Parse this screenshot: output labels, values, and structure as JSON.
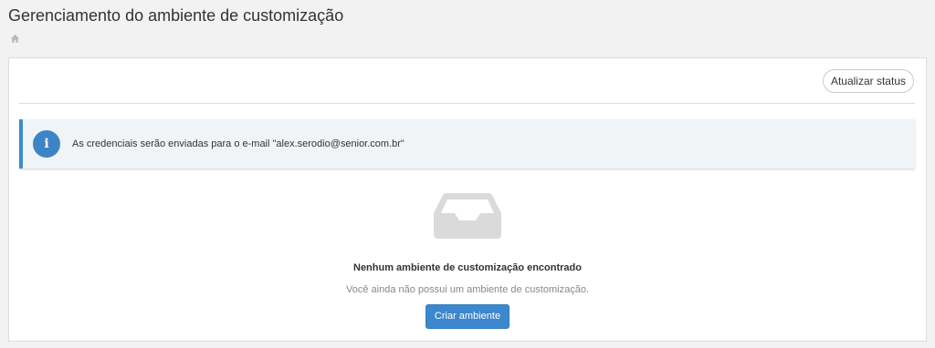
{
  "header": {
    "title": "Gerenciamento do ambiente de customização",
    "breadcrumb_icon": "home-icon"
  },
  "toolbar": {
    "refresh_label": "Atualizar status"
  },
  "alert": {
    "icon": "info-icon",
    "icon_glyph": "i",
    "message": "As credenciais serão enviadas para o e-mail \"alex.serodio@senior.com.br\"",
    "accent_color": "#3c8dce"
  },
  "empty_state": {
    "icon": "inbox-tray-icon",
    "title": "Nenhum ambiente de customização encontrado",
    "description": "Você ainda não possui um ambiente de customização.",
    "action_label": "Criar ambiente",
    "action_color": "#3c87cd"
  }
}
